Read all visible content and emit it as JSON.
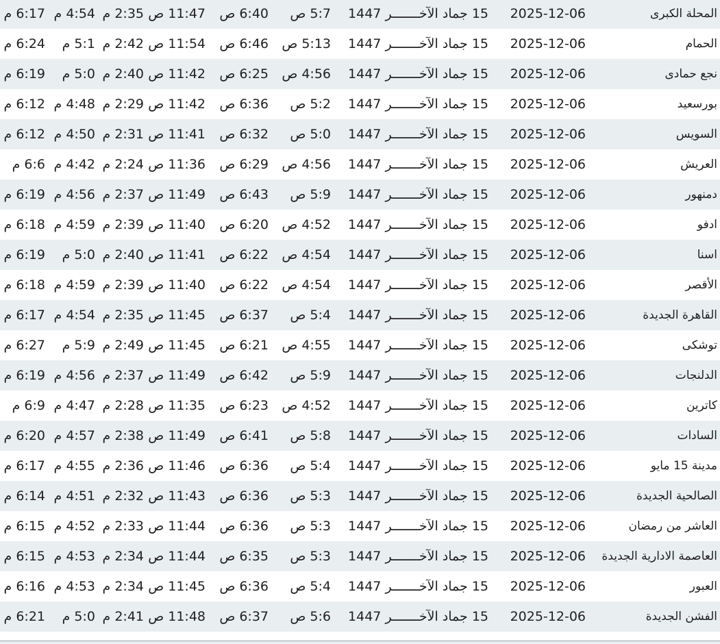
{
  "colors": {
    "row_shade": "#e9eef1",
    "text": "#1f1f1f"
  },
  "table": {
    "rows": [
      {
        "city": "المحلة الكبرى",
        "date": "2025-12-06",
        "hijri": "15 جماد الآخـــــــر 1447",
        "fajr": "5:7 ص",
        "sunrise": "6:40 ص",
        "dhuhr": "11:47 ص",
        "asr": "2:35 م",
        "maghrib": "4:54 م",
        "isha": "6:17 م"
      },
      {
        "city": "الحمام",
        "date": "2025-12-06",
        "hijri": "15 جماد الآخـــــــر 1447",
        "fajr": "5:13 ص",
        "sunrise": "6:46 ص",
        "dhuhr": "11:54 ص",
        "asr": "2:42 م",
        "maghrib": "5:1 م",
        "isha": "6:24 م"
      },
      {
        "city": "نجع حمادى",
        "date": "2025-12-06",
        "hijri": "15 جماد الآخـــــــر 1447",
        "fajr": "4:56 ص",
        "sunrise": "6:25 ص",
        "dhuhr": "11:42 ص",
        "asr": "2:40 م",
        "maghrib": "5:0 م",
        "isha": "6:19 م"
      },
      {
        "city": "بورسعيد",
        "date": "2025-12-06",
        "hijri": "15 جماد الآخـــــــر 1447",
        "fajr": "5:2 ص",
        "sunrise": "6:36 ص",
        "dhuhr": "11:42 ص",
        "asr": "2:29 م",
        "maghrib": "4:48 م",
        "isha": "6:12 م"
      },
      {
        "city": "السويس",
        "date": "2025-12-06",
        "hijri": "15 جماد الآخـــــــر 1447",
        "fajr": "5:0 ص",
        "sunrise": "6:32 ص",
        "dhuhr": "11:41 ص",
        "asr": "2:31 م",
        "maghrib": "4:50 م",
        "isha": "6:12 م"
      },
      {
        "city": "العريش",
        "date": "2025-12-06",
        "hijri": "15 جماد الآخـــــــر 1447",
        "fajr": "4:56 ص",
        "sunrise": "6:29 ص",
        "dhuhr": "11:36 ص",
        "asr": "2:24 م",
        "maghrib": "4:42 م",
        "isha": "6:6 م"
      },
      {
        "city": "دمنهور",
        "date": "2025-12-06",
        "hijri": "15 جماد الآخـــــــر 1447",
        "fajr": "5:9 ص",
        "sunrise": "6:43 ص",
        "dhuhr": "11:49 ص",
        "asr": "2:37 م",
        "maghrib": "4:56 م",
        "isha": "6:19 م"
      },
      {
        "city": "ادفو",
        "date": "2025-12-06",
        "hijri": "15 جماد الآخـــــــر 1447",
        "fajr": "4:52 ص",
        "sunrise": "6:20 ص",
        "dhuhr": "11:40 ص",
        "asr": "2:39 م",
        "maghrib": "4:59 م",
        "isha": "6:18 م"
      },
      {
        "city": "اسنا",
        "date": "2025-12-06",
        "hijri": "15 جماد الآخـــــــر 1447",
        "fajr": "4:54 ص",
        "sunrise": "6:22 ص",
        "dhuhr": "11:41 ص",
        "asr": "2:40 م",
        "maghrib": "5:0 م",
        "isha": "6:19 م"
      },
      {
        "city": "الأقصر",
        "date": "2025-12-06",
        "hijri": "15 جماد الآخـــــــر 1447",
        "fajr": "4:54 ص",
        "sunrise": "6:22 ص",
        "dhuhr": "11:40 ص",
        "asr": "2:39 م",
        "maghrib": "4:59 م",
        "isha": "6:18 م"
      },
      {
        "city": "القاهرة الجديدة",
        "date": "2025-12-06",
        "hijri": "15 جماد الآخـــــــر 1447",
        "fajr": "5:4 ص",
        "sunrise": "6:37 ص",
        "dhuhr": "11:45 ص",
        "asr": "2:35 م",
        "maghrib": "4:54 م",
        "isha": "6:17 م"
      },
      {
        "city": "توشكى",
        "date": "2025-12-06",
        "hijri": "15 جماد الآخـــــــر 1447",
        "fajr": "4:55 ص",
        "sunrise": "6:21 ص",
        "dhuhr": "11:45 ص",
        "asr": "2:49 م",
        "maghrib": "5:9 م",
        "isha": "6:27 م"
      },
      {
        "city": "الدلنجات",
        "date": "2025-12-06",
        "hijri": "15 جماد الآخـــــــر 1447",
        "fajr": "5:9 ص",
        "sunrise": "6:42 ص",
        "dhuhr": "11:49 ص",
        "asr": "2:37 م",
        "maghrib": "4:56 م",
        "isha": "6:19 م"
      },
      {
        "city": "كاترين",
        "date": "2025-12-06",
        "hijri": "15 جماد الآخـــــــر 1447",
        "fajr": "4:52 ص",
        "sunrise": "6:23 ص",
        "dhuhr": "11:35 ص",
        "asr": "2:28 م",
        "maghrib": "4:47 م",
        "isha": "6:9 م"
      },
      {
        "city": "السادات",
        "date": "2025-12-06",
        "hijri": "15 جماد الآخـــــــر 1447",
        "fajr": "5:8 ص",
        "sunrise": "6:41 ص",
        "dhuhr": "11:49 ص",
        "asr": "2:38 م",
        "maghrib": "4:57 م",
        "isha": "6:20 م"
      },
      {
        "city": "مدينة 15 مايو",
        "date": "2025-12-06",
        "hijri": "15 جماد الآخـــــــر 1447",
        "fajr": "5:4 ص",
        "sunrise": "6:36 ص",
        "dhuhr": "11:46 ص",
        "asr": "2:36 م",
        "maghrib": "4:55 م",
        "isha": "6:17 م"
      },
      {
        "city": "الصالحية الجديدة",
        "date": "2025-12-06",
        "hijri": "15 جماد الآخـــــــر 1447",
        "fajr": "5:3 ص",
        "sunrise": "6:36 ص",
        "dhuhr": "11:43 ص",
        "asr": "2:32 م",
        "maghrib": "4:51 م",
        "isha": "6:14 م"
      },
      {
        "city": "العاشر من رمضان",
        "date": "2025-12-06",
        "hijri": "15 جماد الآخـــــــر 1447",
        "fajr": "5:3 ص",
        "sunrise": "6:36 ص",
        "dhuhr": "11:44 ص",
        "asr": "2:33 م",
        "maghrib": "4:52 م",
        "isha": "6:15 م"
      },
      {
        "city": "العاصمة الادارية الجديدة",
        "date": "2025-12-06",
        "hijri": "15 جماد الآخـــــــر 1447",
        "fajr": "5:3 ص",
        "sunrise": "6:35 ص",
        "dhuhr": "11:44 ص",
        "asr": "2:34 م",
        "maghrib": "4:53 م",
        "isha": "6:15 م"
      },
      {
        "city": "العبور",
        "date": "2025-12-06",
        "hijri": "15 جماد الآخـــــــر 1447",
        "fajr": "5:4 ص",
        "sunrise": "6:36 ص",
        "dhuhr": "11:45 ص",
        "asr": "2:34 م",
        "maghrib": "4:53 م",
        "isha": "6:16 م"
      },
      {
        "city": "الفشن الجديدة",
        "date": "2025-12-06",
        "hijri": "15 جماد الآخـــــــر 1447",
        "fajr": "5:6 ص",
        "sunrise": "6:37 ص",
        "dhuhr": "11:48 ص",
        "asr": "2:41 م",
        "maghrib": "5:0 م",
        "isha": "6:21 م"
      }
    ]
  }
}
